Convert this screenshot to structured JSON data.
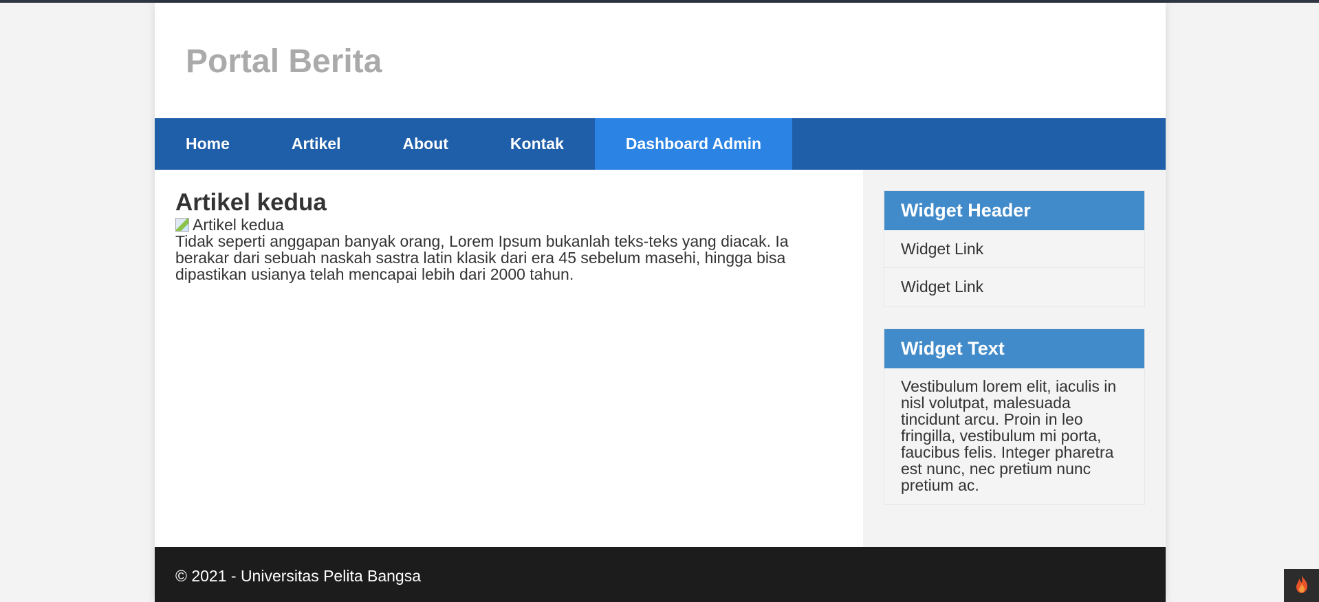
{
  "site": {
    "title": "Portal Berita"
  },
  "nav": {
    "items": [
      {
        "label": "Home"
      },
      {
        "label": "Artikel"
      },
      {
        "label": "About"
      },
      {
        "label": "Kontak"
      },
      {
        "label": "Dashboard Admin"
      }
    ]
  },
  "article": {
    "title": "Artikel kedua",
    "image_alt": "Artikel kedua",
    "body": "Tidak seperti anggapan banyak orang, Lorem Ipsum bukanlah teks-teks yang diacak. Ia berakar dari sebuah naskah sastra latin klasik dari era 45 sebelum masehi, hingga bisa dipastikan usianya telah mencapai lebih dari 2000 tahun."
  },
  "sidebar": {
    "widget_links": {
      "header": "Widget Header",
      "links": [
        {
          "label": "Widget Link"
        },
        {
          "label": "Widget Link"
        }
      ]
    },
    "widget_text": {
      "header": "Widget Text",
      "body": "Vestibulum lorem elit, iaculis in nisl volutpat, malesuada tincidunt arcu. Proin in leo fringilla, vestibulum mi porta, faucibus felis. Integer pharetra est nunc, nec pretium nunc pretium ac."
    }
  },
  "footer": {
    "text": "© 2021 - Universitas Pelita Bangsa"
  },
  "icons": {
    "corner_button": "flame-icon"
  },
  "colors": {
    "nav_bg": "#1f5faa",
    "nav_active": "#2b83e4",
    "widget_header": "#428bca",
    "footer_bg": "#1c1c1c",
    "title": "#aaaaaa"
  }
}
